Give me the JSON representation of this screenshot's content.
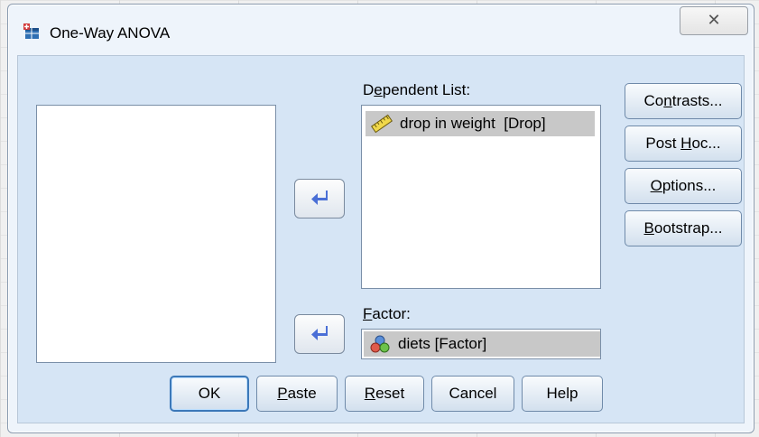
{
  "window": {
    "title": "One-Way ANOVA",
    "close_glyph": "✕"
  },
  "dependent": {
    "label_pre": "D",
    "label_mnemonic": "e",
    "label_post": "pendent List:",
    "items": [
      {
        "label": "drop in weight  [Drop]",
        "icon": "ruler-scale-icon"
      }
    ]
  },
  "factor": {
    "label_pre": "",
    "label_mnemonic": "F",
    "label_post": "actor:",
    "value": "diets [Factor]",
    "icon": "nominal-variable-icon"
  },
  "side_buttons": [
    {
      "pre": "Co",
      "mn": "n",
      "post": "trasts..."
    },
    {
      "pre": "Post ",
      "mn": "H",
      "post": "oc..."
    },
    {
      "pre": "",
      "mn": "O",
      "post": "ptions..."
    },
    {
      "pre": "",
      "mn": "B",
      "post": "ootstrap..."
    }
  ],
  "bottom_buttons": [
    {
      "pre": "OK",
      "mn": "",
      "post": ""
    },
    {
      "pre": "",
      "mn": "P",
      "post": "aste"
    },
    {
      "pre": "",
      "mn": "R",
      "post": "eset"
    },
    {
      "pre": "Cancel",
      "mn": "",
      "post": ""
    },
    {
      "pre": "Help",
      "mn": "",
      "post": ""
    }
  ],
  "colors": {
    "accent": "#3c78b8",
    "arrow": "#4a6fd6",
    "panel": "#d6e5f5"
  }
}
